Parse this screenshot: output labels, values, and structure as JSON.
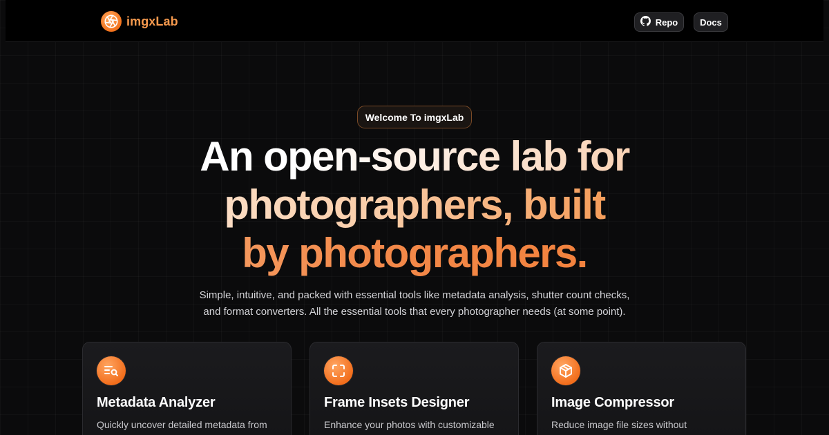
{
  "brand": {
    "name": "imgxLab",
    "accent": "#f79a4e"
  },
  "nav": {
    "repo_label": "Repo",
    "repo_icon": "github-icon",
    "docs_label": "Docs"
  },
  "hero": {
    "badge": "Welcome To imgxLab",
    "title_lines": [
      "An open-source lab for",
      "photographers, built",
      "by photographers."
    ],
    "subtitle_lines": [
      "Simple, intuitive, and packed with essential tools like metadata analysis, shutter count checks,",
      "and format converters. All the essential tools that every photographer needs (at some point)."
    ]
  },
  "features": [
    {
      "icon": "metadata-search-icon",
      "title": "Metadata Analyzer",
      "description": "Quickly uncover detailed metadata from"
    },
    {
      "icon": "frame-icon",
      "title": "Frame Insets Designer",
      "description": "Enhance your photos with customizable"
    },
    {
      "icon": "box-icon",
      "title": "Image Compressor",
      "description": "Reduce image file sizes without"
    }
  ]
}
